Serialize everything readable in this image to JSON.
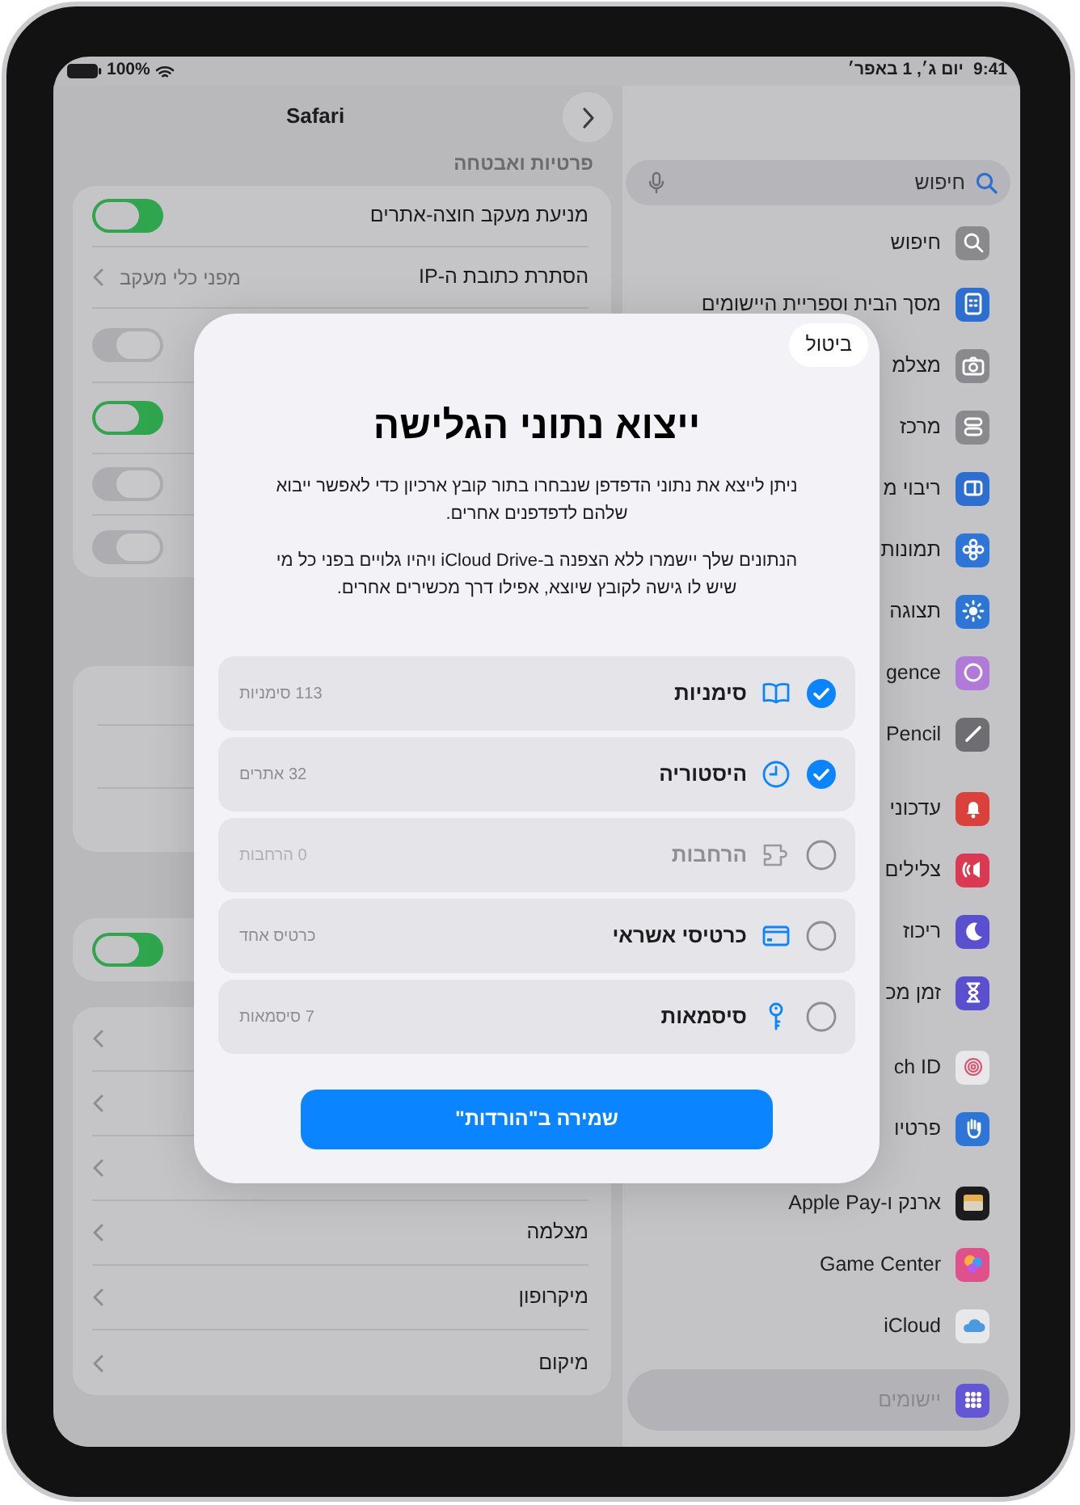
{
  "status_bar": {
    "battery": "100%",
    "date": "יום ג׳, 1 באפר׳",
    "time": "9:41"
  },
  "detail": {
    "title": "Safari",
    "section_header": "פרטיות ואבטחה",
    "privacy_rows": [
      {
        "kind": "toggle",
        "label": "מניעת מעקב חוצה-אתרים",
        "on": true
      },
      {
        "kind": "link",
        "label": "הסתרת כתובת ה-IP",
        "value": "מפני כלי מעקב"
      },
      {
        "kind": "toggle",
        "on": false
      },
      {
        "kind": "toggle",
        "on": true
      },
      {
        "kind": "toggle",
        "on": false
      },
      {
        "kind": "toggle",
        "on": false
      }
    ],
    "standalone_toggle": {
      "on": true
    },
    "permission_rows": [
      {
        "kind": "link"
      },
      {
        "kind": "link"
      },
      {
        "kind": "link"
      },
      {
        "kind": "link",
        "label": "מצלמה"
      },
      {
        "kind": "link",
        "label": "מיקרופון"
      },
      {
        "kind": "link",
        "label": "מיקום"
      }
    ]
  },
  "sidebar": {
    "search": {
      "placeholder": "חיפוש"
    },
    "groups": [
      [
        {
          "label": "חיפוש",
          "color": "#8a8a8e",
          "selected": false
        },
        {
          "label": "מסך הבית וספריית היישומים",
          "color": "#2d6fd1",
          "selected": false
        },
        {
          "label": "מצלמ",
          "color": "#8a8a8e",
          "selected": false
        },
        {
          "label": "מרכז",
          "color": "#8a8a8e",
          "selected": false
        },
        {
          "label": "ריבוי מ",
          "color": "#2d6fd1",
          "selected": false
        },
        {
          "label": "תמונות",
          "color": "#2d75d6",
          "selected": false
        },
        {
          "label": "תצוגה",
          "color": "#2d75d6",
          "selected": false
        },
        {
          "label": "gence",
          "color": "#b07ad8",
          "selected": false
        },
        {
          "label": "Pencil",
          "color": "#6e6e72",
          "selected": false
        }
      ],
      [
        {
          "label": "עדכוני",
          "color": "#d9413a",
          "selected": false
        },
        {
          "label": "צלילים",
          "color": "#d93a52",
          "selected": false
        },
        {
          "label": "ריכוז",
          "color": "#5a4fcf",
          "selected": false
        },
        {
          "label": "זמן מכ",
          "color": "#5a4fcf",
          "selected": false
        }
      ],
      [
        {
          "label": "ch ID",
          "color": "#e8e8ea",
          "selected": false
        },
        {
          "label": "פרטיו",
          "color": "#2d75d6",
          "selected": false
        }
      ],
      [
        {
          "label": "ארנק ו-Apple Pay",
          "color": "#1c1c1e",
          "selected": false
        },
        {
          "label": "Game Center",
          "color": "#e0508a",
          "selected": false
        },
        {
          "label": "iCloud",
          "color": "#e8e8ea",
          "selected": false
        }
      ],
      [
        {
          "label": "יישומים",
          "color": "#6457d6",
          "selected": true
        }
      ]
    ]
  },
  "export_sheet": {
    "cancel": "ביטול",
    "title": "ייצוא נתוני הגלישה",
    "paragraphs": [
      "ניתן לייצא את נתוני הדפדפן שנבחרו בתור קובץ ארכיון כדי לאפשר ייבוא שלהם לדפדפנים אחרים.",
      "הנתונים שלך יישמרו ללא הצפנה ב-iCloud Drive ויהיו גלויים בפני כל מי שיש לו גישה לקובץ שיוצא, אפילו דרך מכשירים אחרים."
    ],
    "items": [
      {
        "label": "סימניות",
        "count": "113 סימניות",
        "checked": true,
        "disabled": false
      },
      {
        "label": "היסטוריה",
        "count": "32 אתרים",
        "checked": true,
        "disabled": false
      },
      {
        "label": "הרחבות",
        "count": "0 הרחבות",
        "checked": false,
        "disabled": true
      },
      {
        "label": "כרטיסי אשראי",
        "count": "כרטיס אחד",
        "checked": false,
        "disabled": false
      },
      {
        "label": "סיסמאות",
        "count": "7 סיסמאות",
        "checked": false,
        "disabled": false
      }
    ],
    "save_button": "שמירה ב\"הורדות\""
  }
}
